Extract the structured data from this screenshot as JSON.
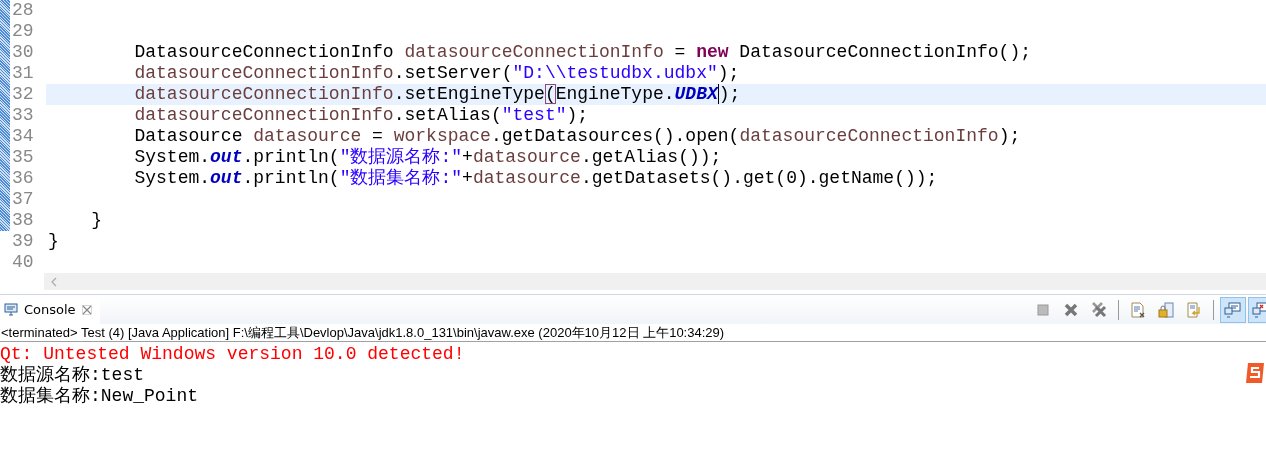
{
  "editor": {
    "lines": [
      {
        "number": "28",
        "current": false
      },
      {
        "number": "29",
        "current": false
      },
      {
        "number": "30",
        "current": false,
        "tokens": [
          {
            "kind": "plain",
            "text": "        DatasourceConnectionInfo "
          },
          {
            "kind": "field",
            "text": "datasourceConnectionInfo"
          },
          {
            "kind": "plain",
            "text": " = "
          },
          {
            "kind": "keyword",
            "text": "new"
          },
          {
            "kind": "plain",
            "text": " DatasourceConnectionInfo();"
          }
        ]
      },
      {
        "number": "31",
        "current": false,
        "tokens": [
          {
            "kind": "field",
            "text": "        datasourceConnectionInfo"
          },
          {
            "kind": "plain",
            "text": ".setServer("
          },
          {
            "kind": "string",
            "text": "\"D:\\\\testudbx.udbx\""
          },
          {
            "kind": "plain",
            "text": ");"
          }
        ]
      },
      {
        "number": "32",
        "current": true,
        "tokens": [
          {
            "kind": "field",
            "text": "        datasourceConnectionInfo"
          },
          {
            "kind": "plain",
            "text": ".setEngineType"
          },
          {
            "kind": "plain",
            "text": "(",
            "bracket_match": true
          },
          {
            "kind": "plain",
            "text": "EngineType."
          },
          {
            "kind": "static",
            "text": "UDBX",
            "caret": true
          },
          {
            "kind": "plain",
            "text": ");"
          }
        ]
      },
      {
        "number": "33",
        "current": false,
        "tokens": [
          {
            "kind": "field",
            "text": "        datasourceConnectionInfo"
          },
          {
            "kind": "plain",
            "text": ".setAlias("
          },
          {
            "kind": "string",
            "text": "\"test\""
          },
          {
            "kind": "plain",
            "text": ");"
          }
        ]
      },
      {
        "number": "34",
        "current": false,
        "tokens": [
          {
            "kind": "plain",
            "text": "        Datasource "
          },
          {
            "kind": "field",
            "text": "datasource"
          },
          {
            "kind": "plain",
            "text": " = "
          },
          {
            "kind": "field",
            "text": "workspace"
          },
          {
            "kind": "plain",
            "text": ".getDatasources().open("
          },
          {
            "kind": "field",
            "text": "datasourceConnectionInfo"
          },
          {
            "kind": "plain",
            "text": ");"
          }
        ]
      },
      {
        "number": "35",
        "current": false,
        "tokens": [
          {
            "kind": "plain",
            "text": "        System."
          },
          {
            "kind": "static",
            "text": "out"
          },
          {
            "kind": "plain",
            "text": ".println("
          },
          {
            "kind": "string",
            "text": "\"数据源名称:\""
          },
          {
            "kind": "plain",
            "text": "+"
          },
          {
            "kind": "field",
            "text": "datasource"
          },
          {
            "kind": "plain",
            "text": ".getAlias());"
          }
        ]
      },
      {
        "number": "36",
        "current": false,
        "tokens": [
          {
            "kind": "plain",
            "text": "        System."
          },
          {
            "kind": "static",
            "text": "out"
          },
          {
            "kind": "plain",
            "text": ".println("
          },
          {
            "kind": "string",
            "text": "\"数据集名称:\""
          },
          {
            "kind": "plain",
            "text": "+"
          },
          {
            "kind": "field",
            "text": "datasource"
          },
          {
            "kind": "plain",
            "text": ".getDatasets().get(0).getName());"
          }
        ]
      },
      {
        "number": "37",
        "current": false
      },
      {
        "number": "38",
        "current": false,
        "tokens": [
          {
            "kind": "plain",
            "text": "    }"
          }
        ]
      },
      {
        "number": "39",
        "current": false,
        "tokens": [
          {
            "kind": "plain",
            "text": "}"
          }
        ]
      },
      {
        "number": "40",
        "current": false
      }
    ]
  },
  "console": {
    "tab": {
      "label": "Console",
      "selected": true
    },
    "toolbar": [
      {
        "kind": "terminate",
        "on": false
      },
      {
        "kind": "remove",
        "on": false
      },
      {
        "kind": "remove-all",
        "on": false
      },
      {
        "kind": "clear",
        "on": false
      },
      {
        "kind": "scroll-lock",
        "on": false
      },
      {
        "kind": "word-wrap",
        "on": false
      },
      {
        "kind": "stdout",
        "on": true
      },
      {
        "kind": "stderr",
        "on": true
      }
    ],
    "status": "<terminated> Test (4) [Java Application] F:\\编程工具\\Devlop\\Java\\jdk1.8.0_131\\bin\\javaw.exe (2020年10月12日 上午10:34:29)",
    "output": [
      {
        "kind": "stderr",
        "text": "Qt: Untested Windows version 10.0 detected!"
      },
      {
        "kind": "stdout",
        "text": "数据源名称:test"
      },
      {
        "kind": "stdout",
        "text": "数据集名称:New_Point"
      }
    ]
  }
}
